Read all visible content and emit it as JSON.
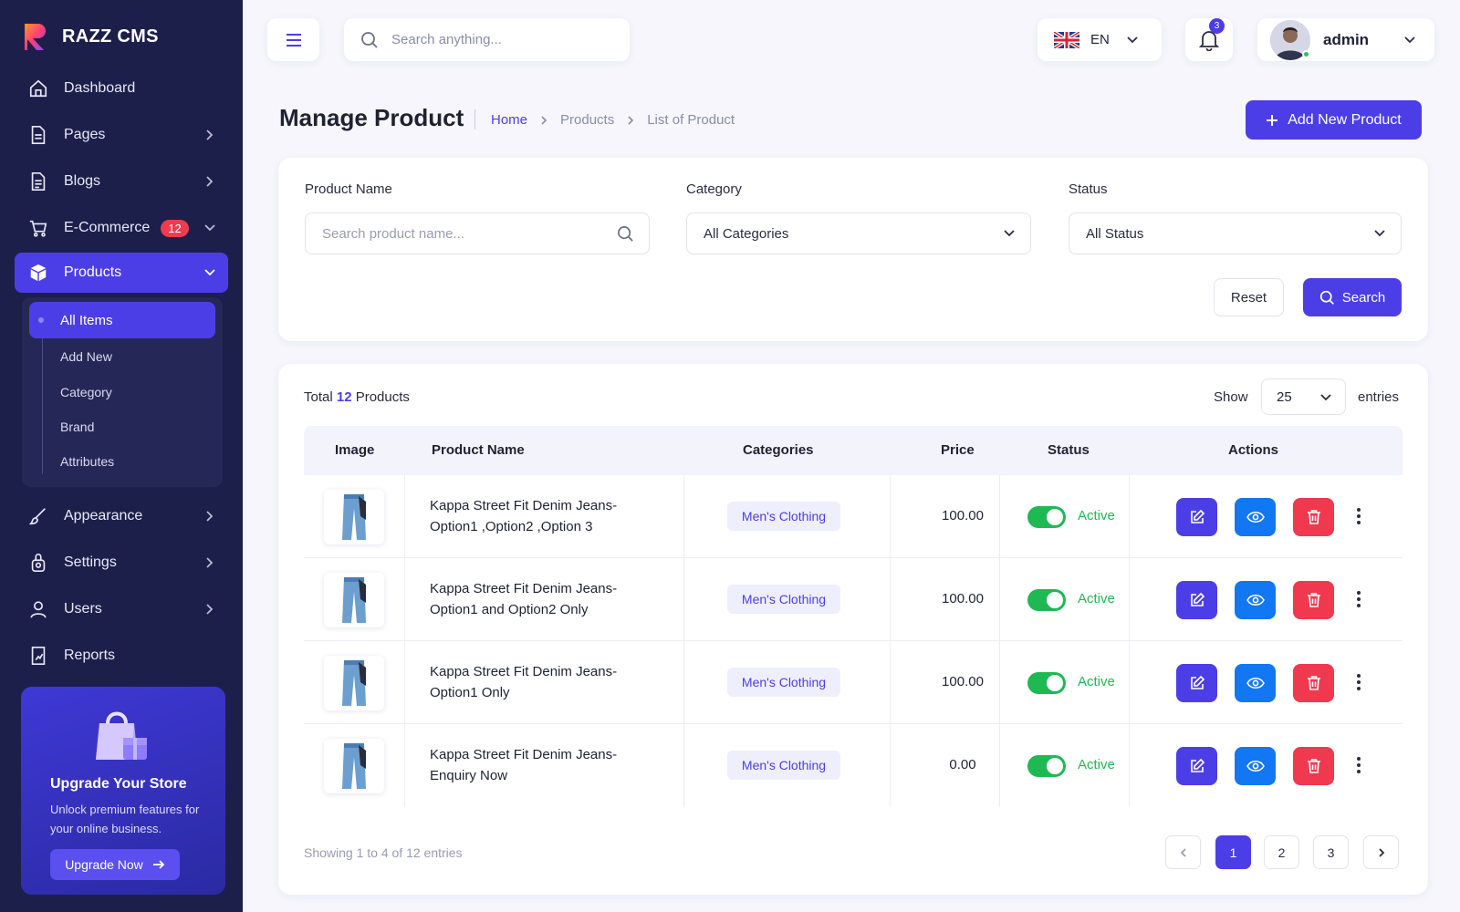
{
  "brand": {
    "name": "RAZZ CMS"
  },
  "sidebar": {
    "items": [
      {
        "label": "Dashboard",
        "icon": "home-icon"
      },
      {
        "label": "Pages",
        "icon": "page-icon"
      },
      {
        "label": "Blogs",
        "icon": "blog-icon"
      },
      {
        "label": "E-Commerce",
        "icon": "cart-icon",
        "badge": "12"
      },
      {
        "label": "Products",
        "icon": "box-icon"
      },
      {
        "label": "Appearance",
        "icon": "brush-icon"
      },
      {
        "label": "Settings",
        "icon": "settings-icon"
      },
      {
        "label": "Users",
        "icon": "user-icon"
      },
      {
        "label": "Reports",
        "icon": "report-icon"
      }
    ],
    "submenu": [
      "All Items",
      "Add New",
      "Category",
      "Brand",
      "Attributes"
    ],
    "upgrade": {
      "title": "Upgrade Your Store",
      "text": "Unlock premium features for your online business.",
      "button": "Upgrade Now"
    }
  },
  "topbar": {
    "search_placeholder": "Search anything...",
    "language": "EN",
    "notifications": "3",
    "user": "admin"
  },
  "page": {
    "title": "Manage Product",
    "breadcrumb": [
      "Home",
      "Products",
      "List of Product"
    ],
    "add_button": "Add New Product"
  },
  "filter": {
    "product_name_label": "Product Name",
    "product_name_placeholder": "Search product name...",
    "category_label": "Category",
    "category_value": "All Categories",
    "status_label": "Status",
    "status_value": "All Status",
    "reset": "Reset",
    "search": "Search"
  },
  "table": {
    "total_prefix": "Total",
    "total_count": "12",
    "total_suffix": "Products",
    "show": "Show",
    "entries_value": "25",
    "entries": "entries",
    "headers": [
      "Image",
      "Product Name",
      "Categories",
      "Price",
      "Status",
      "Actions"
    ],
    "rows": [
      {
        "name1": "Kappa Street Fit Denim Jeans-",
        "name2": "Option1 ,Option2 ,Option 3",
        "category": "Men's Clothing",
        "price": "100.00",
        "status": "Active"
      },
      {
        "name1": "Kappa Street Fit Denim Jeans-",
        "name2": "Option1 and Option2 Only",
        "category": "Men's Clothing",
        "price": "100.00",
        "status": "Active"
      },
      {
        "name1": "Kappa Street Fit Denim Jeans-",
        "name2": "Option1 Only",
        "category": "Men's Clothing",
        "price": "100.00",
        "status": "Active"
      },
      {
        "name1": "Kappa Street Fit Denim Jeans-",
        "name2": "Enquiry Now",
        "category": "Men's Clothing",
        "price": "0.00",
        "status": "Active"
      }
    ],
    "showing": "Showing 1 to 4 of 12 entries",
    "pages": [
      "1",
      "2",
      "3"
    ]
  },
  "colors": {
    "accent": "#4c3ee6",
    "sidebar": "#1d1f4b",
    "success": "#1fb954",
    "danger": "#f0394f",
    "info": "#1277f2"
  }
}
